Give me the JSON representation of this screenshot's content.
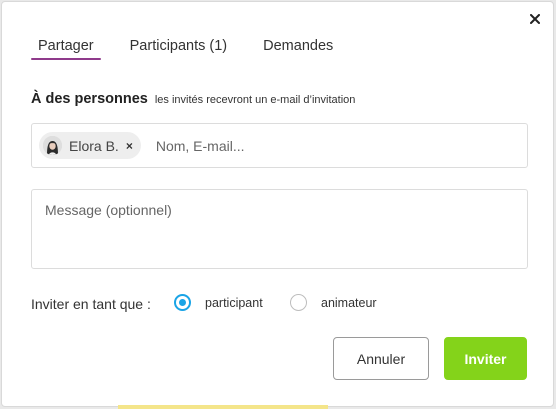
{
  "tabs": [
    {
      "label": "Partager",
      "active": true
    },
    {
      "label": "Participants (1)",
      "active": false
    },
    {
      "label": "Demandes",
      "active": false
    }
  ],
  "recipients_section": {
    "title": "À des personnes",
    "subtitle": "les invités recevront un e-mail d’invitation"
  },
  "recipient_chip": {
    "name": "Elora B.",
    "remove_glyph": "×"
  },
  "recipient_input": {
    "placeholder": "Nom, E-mail..."
  },
  "message": {
    "placeholder": "Message (optionnel)"
  },
  "role": {
    "label": "Inviter en tant que :",
    "options": [
      {
        "label": "participant",
        "checked": true
      },
      {
        "label": "animateur",
        "checked": false
      }
    ]
  },
  "buttons": {
    "cancel": "Annuler",
    "invite": "Inviter"
  },
  "colors": {
    "tab_underline": "#8f3a8b",
    "radio_accent": "#1aa4e6",
    "invite_button": "#84d31a"
  },
  "icons": {
    "close": "close-icon",
    "avatar": "user-avatar"
  }
}
